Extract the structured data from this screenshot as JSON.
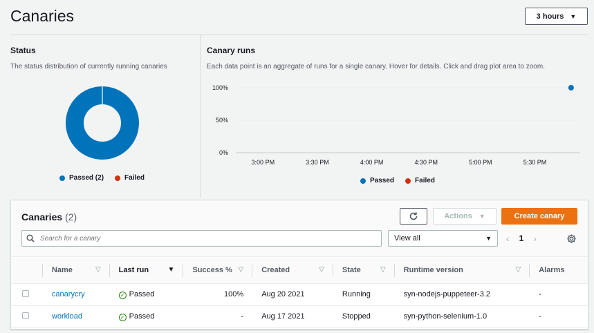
{
  "page": {
    "title": "Canaries",
    "range_label": "3 hours"
  },
  "colors": {
    "passed": "#0073bb",
    "failed": "#d13212",
    "accent": "#ec7211",
    "link": "#0073bb"
  },
  "status": {
    "title": "Status",
    "description": "The status distribution of currently running canaries",
    "legend": [
      {
        "label": "Passed (2)",
        "color": "#0073bb"
      },
      {
        "label": "Failed",
        "color": "#d13212"
      }
    ]
  },
  "runs": {
    "title": "Canary runs",
    "description": "Each data point is an aggregate of runs for a single canary. Hover for details. Click and drag plot area to zoom.",
    "legend": [
      {
        "label": "Passed",
        "color": "#0073bb"
      },
      {
        "label": "Failed",
        "color": "#d13212"
      }
    ]
  },
  "chart_data": [
    {
      "type": "pie",
      "categories": [
        "Passed",
        "Failed"
      ],
      "values": [
        2,
        0
      ],
      "title": "Status"
    },
    {
      "type": "scatter",
      "title": "Canary runs",
      "x_ticks": [
        "3:00 PM",
        "3:30 PM",
        "4:00 PM",
        "4:30 PM",
        "5:00 PM",
        "5:30 PM"
      ],
      "y_ticks": [
        "0%",
        "50%",
        "100%"
      ],
      "ylim": [
        0,
        100
      ],
      "xlim_minutes": [
        -15,
        175
      ],
      "series": [
        {
          "name": "Passed",
          "points": [
            {
              "x": 170,
              "y": 100
            }
          ]
        },
        {
          "name": "Failed",
          "points": []
        }
      ]
    }
  ],
  "table": {
    "title": "Canaries",
    "count": "(2)",
    "refresh_icon": "refresh-icon",
    "actions_label": "Actions",
    "create_label": "Create canary",
    "search_placeholder": "Search for a canary",
    "filter_value": "View all",
    "page": "1",
    "columns": [
      "Name",
      "Last run",
      "Success %",
      "Created",
      "State",
      "Runtime version",
      "Alarms"
    ],
    "rows": [
      {
        "name": "canarycry",
        "last_run": "Passed",
        "success": "100%",
        "created": "Aug 20 2021",
        "state": "Running",
        "runtime": "syn-nodejs-puppeteer-3.2",
        "alarms": "-"
      },
      {
        "name": "workload",
        "last_run": "Passed",
        "success": "-",
        "created": "Aug 17 2021",
        "state": "Stopped",
        "runtime": "syn-python-selenium-1.0",
        "alarms": "-"
      }
    ]
  }
}
